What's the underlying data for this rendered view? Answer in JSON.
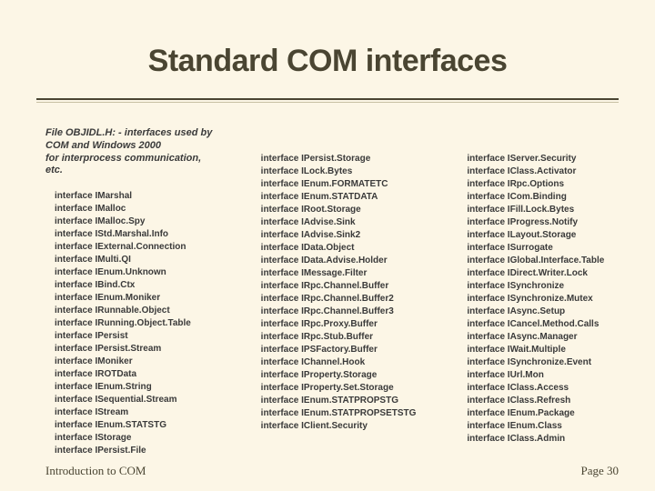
{
  "title": "Standard COM interfaces",
  "file_note": "File OBJIDL.H: - interfaces used by\nCOM and Windows 2000\nfor interprocess communication, etc.",
  "columns": [
    [
      "interface IMarshal",
      "interface IMalloc",
      "interface IMalloc.Spy",
      "interface IStd.Marshal.Info",
      "interface IExternal.Connection",
      "interface IMulti.QI",
      "interface IEnum.Unknown",
      "interface IBind.Ctx",
      "interface IEnum.Moniker",
      "interface IRunnable.Object",
      "interface IRunning.Object.Table",
      "interface IPersist",
      "interface IPersist.Stream",
      "interface IMoniker",
      "interface IROTData",
      "interface IEnum.String",
      "interface ISequential.Stream",
      "interface IStream",
      "interface IEnum.STATSTG",
      "interface IStorage",
      "interface IPersist.File"
    ],
    [
      "interface IPersist.Storage",
      "interface ILock.Bytes",
      "interface IEnum.FORMATETC",
      "interface IEnum.STATDATA",
      "interface IRoot.Storage",
      "interface IAdvise.Sink",
      "interface IAdvise.Sink2",
      "interface IData.Object",
      "interface IData.Advise.Holder",
      "interface IMessage.Filter",
      "interface IRpc.Channel.Buffer",
      "interface IRpc.Channel.Buffer2",
      "interface IRpc.Channel.Buffer3",
      "interface IRpc.Proxy.Buffer",
      "interface IRpc.Stub.Buffer",
      "interface IPSFactory.Buffer",
      "interface IChannel.Hook",
      "interface IProperty.Storage",
      "interface IProperty.Set.Storage",
      "interface IEnum.STATPROPSTG",
      "interface IEnum.STATPROPSETSTG",
      "interface IClient.Security"
    ],
    [
      "interface IServer.Security",
      "interface IClass.Activator",
      "interface IRpc.Options",
      "interface ICom.Binding",
      "interface IFill.Lock.Bytes",
      "interface IProgress.Notify",
      "interface ILayout.Storage",
      "interface ISurrogate",
      "interface IGlobal.Interface.Table",
      "interface IDirect.Writer.Lock",
      "interface ISynchronize",
      "interface ISynchronize.Mutex",
      "interface IAsync.Setup",
      "interface ICancel.Method.Calls",
      "interface IAsync.Manager",
      "interface IWait.Multiple",
      "interface ISynchronize.Event",
      "interface IUrl.Mon",
      "interface IClass.Access",
      "interface IClass.Refresh",
      "interface IEnum.Package",
      "interface IEnum.Class",
      "interface IClass.Admin"
    ]
  ],
  "footer": {
    "left": "Introduction to COM",
    "right": "Page 30"
  }
}
